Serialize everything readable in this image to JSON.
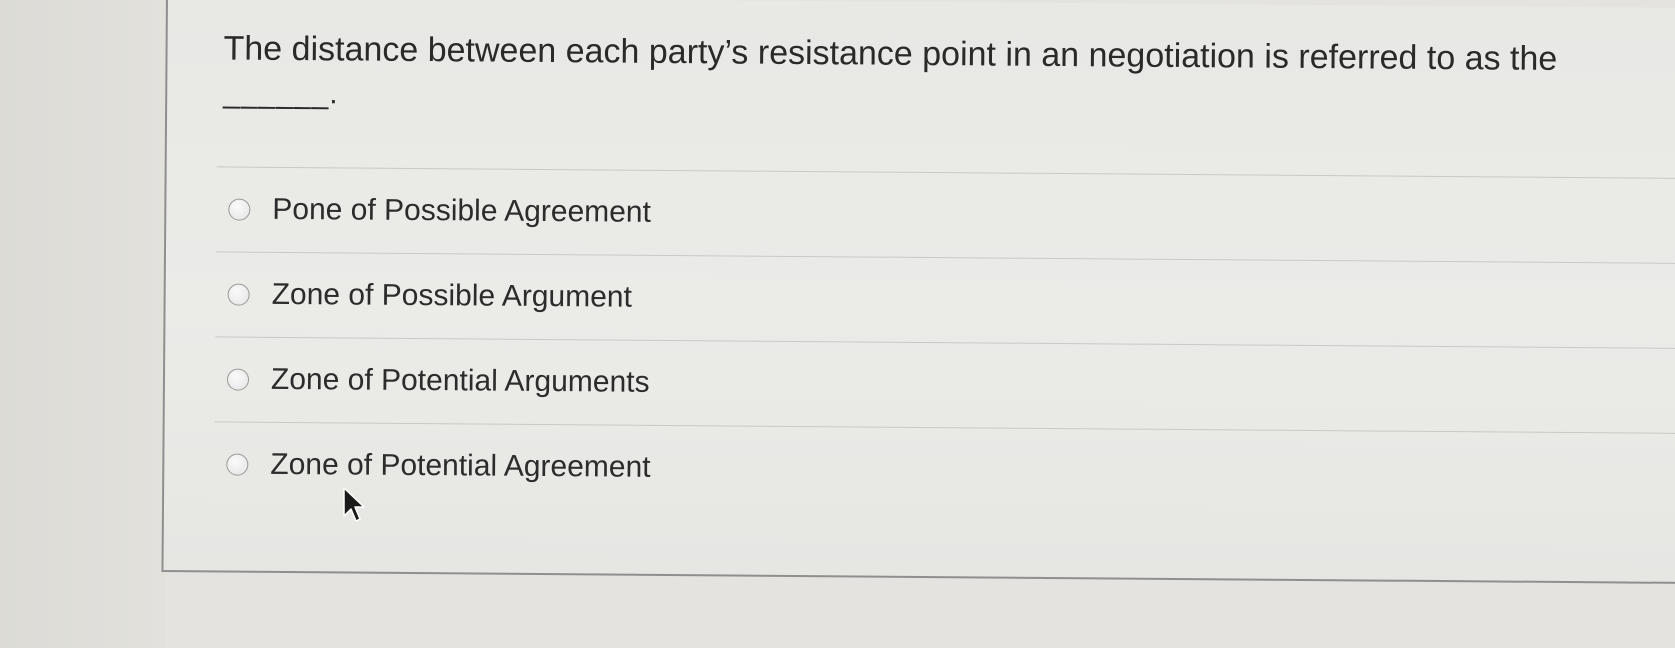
{
  "question": {
    "text": "The distance between each party’s resistance point in an negotiation is referred to as the",
    "blank": "______."
  },
  "options": [
    {
      "label": "Pone of Possible Agreement"
    },
    {
      "label": "Zone of Possible Argument"
    },
    {
      "label": "Zone of Potential Arguments"
    },
    {
      "label": "Zone of Potential Agreement"
    }
  ],
  "icons": {
    "radio": "radio-button-icon",
    "cursor": "mouse-pointer-icon"
  }
}
